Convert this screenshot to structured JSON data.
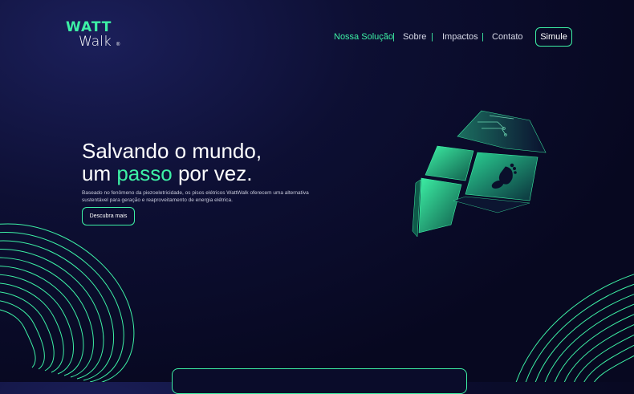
{
  "brand": {
    "line1": "WATT",
    "line2": "Walk",
    "mark": "®"
  },
  "nav": {
    "items": [
      {
        "label": "Nossa Solução",
        "active": true
      },
      {
        "label": "Sobre",
        "active": false
      },
      {
        "label": "Impactos",
        "active": false
      },
      {
        "label": "Contato",
        "active": false
      }
    ],
    "separator": "|",
    "cta": "Simule"
  },
  "hero": {
    "title_line1": "Salvando o mundo,",
    "title_line2_pre": "um ",
    "title_line2_highlight": "passo",
    "title_line2_post": " por vez.",
    "description": "Baseado no fenômeno da piezoeletricidade, os pisos elétricos WattWalk oferecem uma alternativa sustentável para geração e reaproveitamento de energia elétrica.",
    "button": "Descubra mais"
  },
  "colors": {
    "accent": "#3df0a5",
    "background": "#070820",
    "text": "#ffffff"
  },
  "icons": [
    "footprint-icon",
    "circuit-icon"
  ]
}
